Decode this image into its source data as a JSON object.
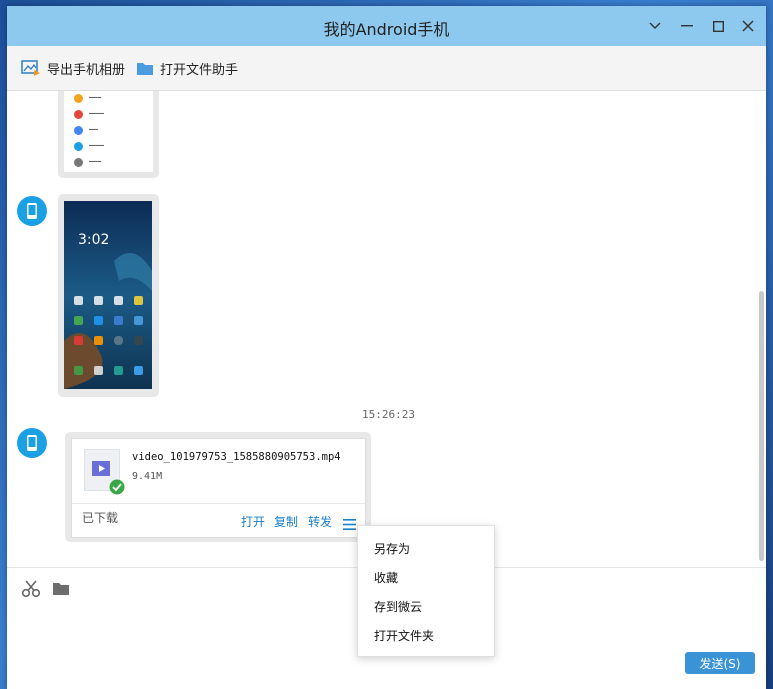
{
  "window": {
    "title": "我的Android手机"
  },
  "toolbar": {
    "export_album": "导出手机相册",
    "open_file_helper": "打开文件助手"
  },
  "chat": {
    "timestamp": "15:26:23",
    "phone_screen_time": "3:02",
    "file": {
      "name": "video_101979753_1585880905753.mp4",
      "size": "9.41M",
      "status": "已下载",
      "actions": {
        "open": "打开",
        "copy": "复制",
        "forward": "转发"
      }
    }
  },
  "context_menu": {
    "items": [
      "另存为",
      "收藏",
      "存到微云",
      "打开文件夹"
    ]
  },
  "input": {
    "send_label": "发送(S)"
  },
  "colors": {
    "titlebar": "#8dc8ee",
    "avatar": "#1aa0e4",
    "link": "#1a7fc8",
    "send": "#3a93d6",
    "check": "#3aa846"
  }
}
